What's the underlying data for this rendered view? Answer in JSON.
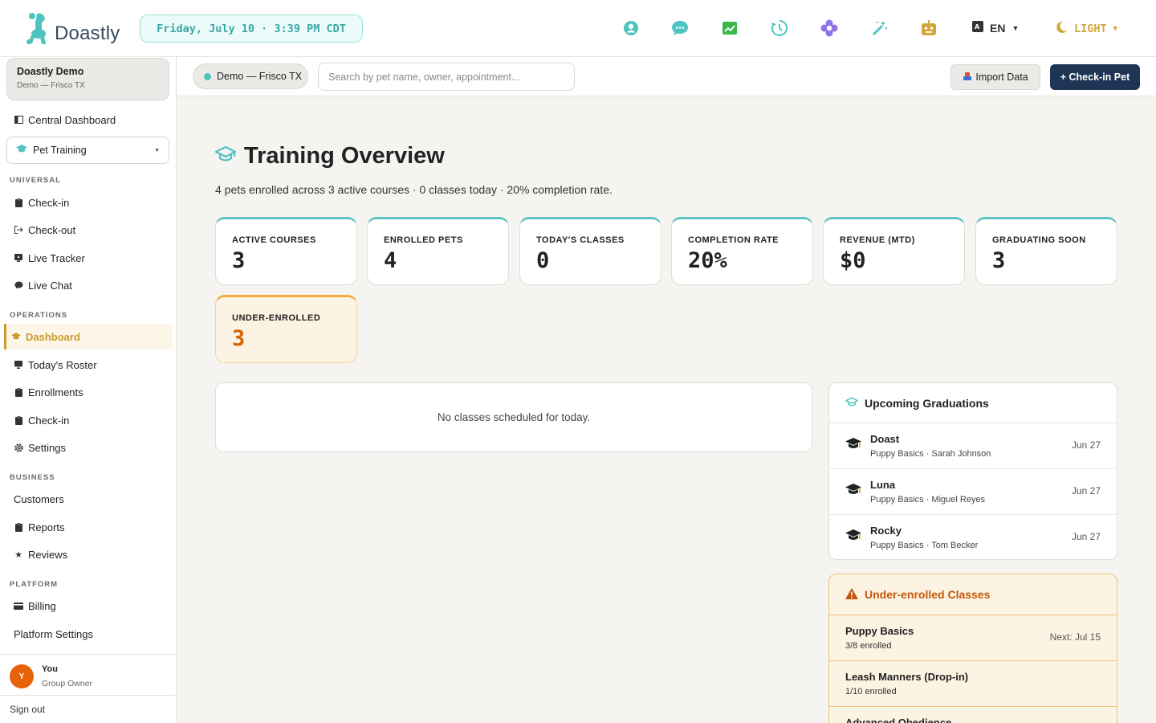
{
  "brand": {
    "name": "Doastly",
    "accent": "#5cc3c0",
    "navy": "#1e3555",
    "gold": "#c99a2c"
  },
  "header": {
    "datetime": "Friday, July 10 · 3:39 PM CDT",
    "icons": [
      "support-icon",
      "chat-icon",
      "analytics-icon",
      "history-icon",
      "flower-icon",
      "magic-wand-icon",
      "robot-icon"
    ],
    "language": "EN",
    "theme": "LIGHT"
  },
  "sidebar": {
    "org_name": "Doastly Demo",
    "org_location": "Demo — Frisco TX",
    "central_dashboard": "Central Dashboard",
    "module_select": "Pet Training",
    "sections": {
      "universal": "UNIVERSAL",
      "operations": "OPERATIONS",
      "business": "BUSINESS",
      "platform": "PLATFORM"
    },
    "universal_items": [
      "Check-in",
      "Check-out",
      "Live Tracker",
      "Live Chat"
    ],
    "operations_items": [
      "Dashboard",
      "Today's Roster",
      "Enrollments",
      "Check-in",
      "Settings"
    ],
    "business_items": [
      "Customers",
      "Reports",
      "Reviews"
    ],
    "platform_items": [
      "Billing",
      "Platform Settings"
    ],
    "user": {
      "initial": "Y",
      "name": "You",
      "role": "Group Owner"
    },
    "sign_out": "Sign out"
  },
  "subbar": {
    "location": "Demo — Frisco TX",
    "search_placeholder": "Search by pet name, owner, appointment...",
    "import_label": "Import Data",
    "checkin_label": "+ Check-in Pet"
  },
  "main": {
    "title": "Training Overview",
    "summary": "4 pets enrolled across 3 active courses · 0 classes today · 20% completion rate.",
    "stats": [
      {
        "label": "ACTIVE COURSES",
        "value": "3"
      },
      {
        "label": "ENROLLED PETS",
        "value": "4"
      },
      {
        "label": "TODAY'S CLASSES",
        "value": "0"
      },
      {
        "label": "COMPLETION RATE",
        "value": "20%"
      },
      {
        "label": "REVENUE (MTD)",
        "value": "$0"
      },
      {
        "label": "GRADUATING SOON",
        "value": "3"
      },
      {
        "label": "UNDER-ENROLLED",
        "value": "3"
      }
    ],
    "empty_classes": "No classes scheduled for today.",
    "graduations": {
      "title": "Upcoming Graduations",
      "rows": [
        {
          "name": "Doast",
          "detail": "Puppy Basics · Sarah Johnson",
          "date": "Jun 27"
        },
        {
          "name": "Luna",
          "detail": "Puppy Basics · Miguel Reyes",
          "date": "Jun 27"
        },
        {
          "name": "Rocky",
          "detail": "Puppy Basics · Tom Becker",
          "date": "Jun 27"
        }
      ]
    },
    "under_enrolled": {
      "title": "Under-enrolled Classes",
      "rows": [
        {
          "name": "Puppy Basics",
          "detail": "3/8 enrolled",
          "next": "Next: Jul 15"
        },
        {
          "name": "Leash Manners (Drop-in)",
          "detail": "1/10 enrolled",
          "next": ""
        },
        {
          "name": "Advanced Obedience",
          "detail": "",
          "next": ""
        }
      ]
    }
  }
}
